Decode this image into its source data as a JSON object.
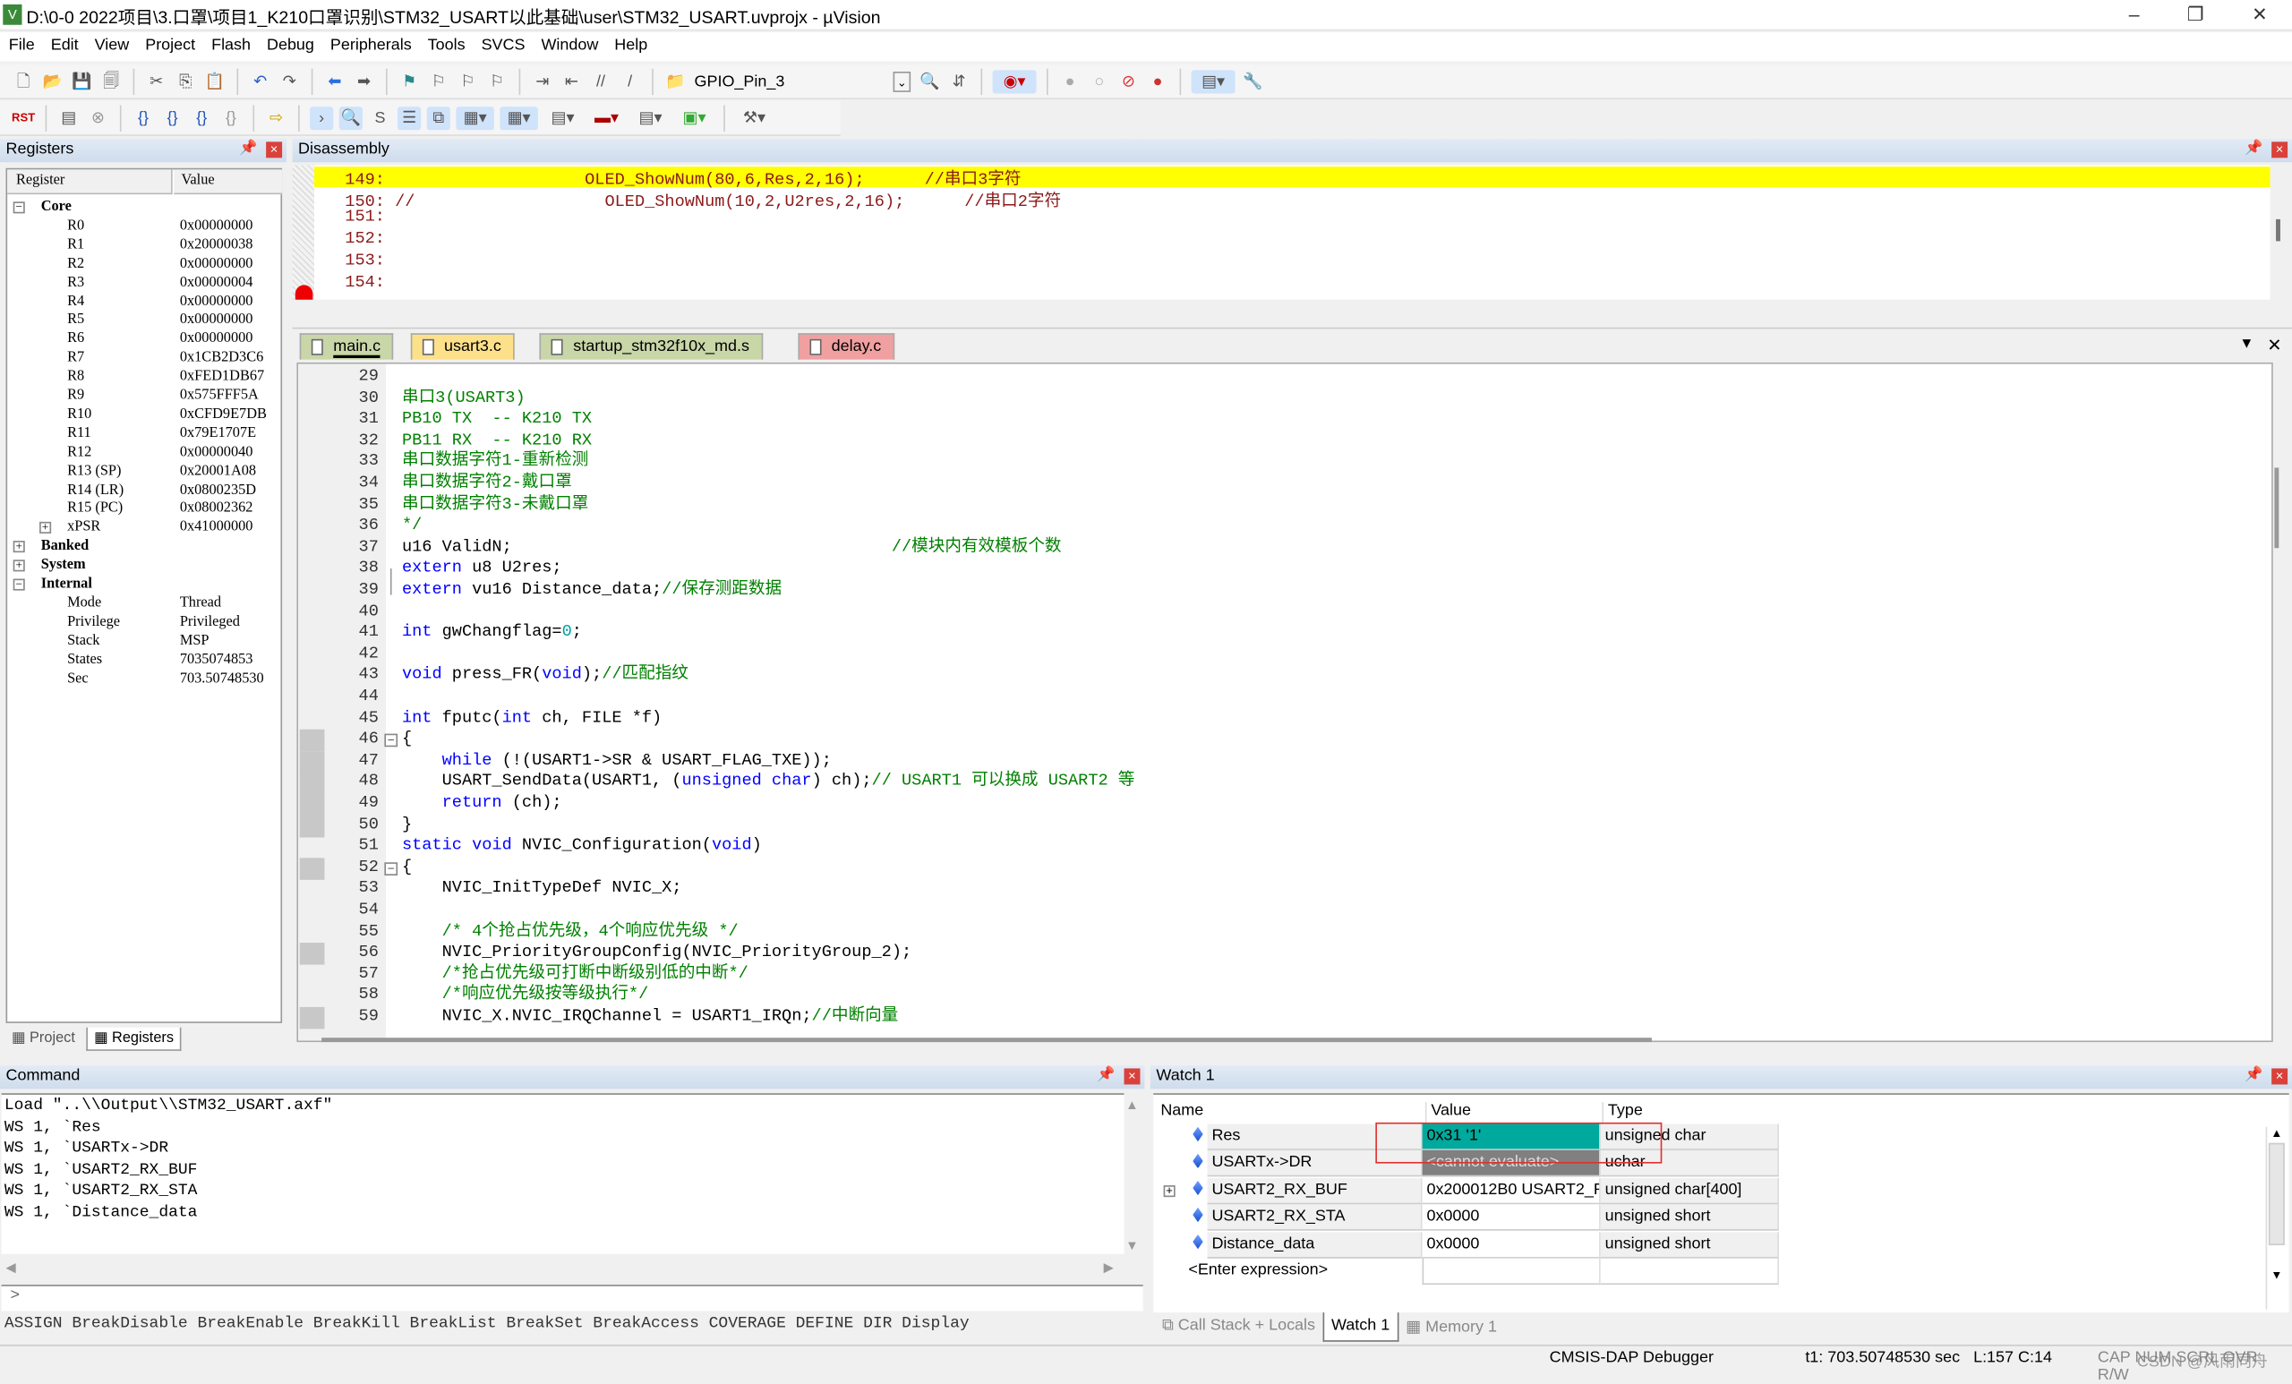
{
  "window": {
    "title": "D:\\0-0 2022项目\\3.口罩\\项目1_K210口罩识别\\STM32_USART以此基础\\user\\STM32_USART.uvprojx - µVision",
    "app_icon": "V"
  },
  "menu": [
    "File",
    "Edit",
    "View",
    "Project",
    "Flash",
    "Debug",
    "Peripherals",
    "Tools",
    "SVCS",
    "Window",
    "Help"
  ],
  "toolbar": {
    "target_combo": "GPIO_Pin_3",
    "rst_label": "RST"
  },
  "registers": {
    "title": "Registers",
    "col_register": "Register",
    "col_value": "Value",
    "rows": [
      {
        "name": "Core",
        "value": "",
        "level": 0,
        "exp": "-"
      },
      {
        "name": "R0",
        "value": "0x00000000",
        "level": 2
      },
      {
        "name": "R1",
        "value": "0x20000038",
        "level": 2
      },
      {
        "name": "R2",
        "value": "0x00000000",
        "level": 2
      },
      {
        "name": "R3",
        "value": "0x00000004",
        "level": 2
      },
      {
        "name": "R4",
        "value": "0x00000000",
        "level": 2
      },
      {
        "name": "R5",
        "value": "0x00000000",
        "level": 2
      },
      {
        "name": "R6",
        "value": "0x00000000",
        "level": 2
      },
      {
        "name": "R7",
        "value": "0x1CB2D3C6",
        "level": 2
      },
      {
        "name": "R8",
        "value": "0xFED1DB67",
        "level": 2
      },
      {
        "name": "R9",
        "value": "0x575FFF5A",
        "level": 2
      },
      {
        "name": "R10",
        "value": "0xCFD9E7DB",
        "level": 2
      },
      {
        "name": "R11",
        "value": "0x79E1707E",
        "level": 2
      },
      {
        "name": "R12",
        "value": "0x00000040",
        "level": 2
      },
      {
        "name": "R13 (SP)",
        "value": "0x20001A08",
        "level": 2
      },
      {
        "name": "R14 (LR)",
        "value": "0x0800235D",
        "level": 2
      },
      {
        "name": "R15 (PC)",
        "value": "0x08002362",
        "level": 2
      },
      {
        "name": "xPSR",
        "value": "0x41000000",
        "level": 1,
        "exp": "+"
      },
      {
        "name": "Banked",
        "value": "",
        "level": 0,
        "exp": "+"
      },
      {
        "name": "System",
        "value": "",
        "level": 0,
        "exp": "+"
      },
      {
        "name": "Internal",
        "value": "",
        "level": 0,
        "exp": "-"
      },
      {
        "name": "Mode",
        "value": "Thread",
        "level": 2
      },
      {
        "name": "Privilege",
        "value": "Privileged",
        "level": 2
      },
      {
        "name": "Stack",
        "value": "MSP",
        "level": 2
      },
      {
        "name": "States",
        "value": "7035074853",
        "level": 2
      },
      {
        "name": "Sec",
        "value": "703.50748530",
        "level": 2
      }
    ],
    "tabs": [
      {
        "label": "Project"
      },
      {
        "label": "Registers"
      }
    ]
  },
  "disassembly": {
    "title": "Disassembly",
    "lines": [
      {
        "n": "149:",
        "code": "                    OLED_ShowNum(80,6,Res,2,16);",
        "comment": "//串口3字符",
        "current": true
      },
      {
        "n": "150:",
        "code": " //                   OLED_ShowNum(10,2,U2res,2,16);",
        "comment": "//串口2字符"
      },
      {
        "n": "151:",
        "code": ""
      },
      {
        "n": "152:",
        "code": ""
      },
      {
        "n": "153:",
        "code": ""
      },
      {
        "n": "154:",
        "code": ""
      }
    ]
  },
  "editor": {
    "tabs": [
      {
        "label": "main.c",
        "color": "#c8d6a8",
        "active": true
      },
      {
        "label": "usart3.c",
        "color": "#fde08a"
      },
      {
        "label": "startup_stm32f10x_md.s",
        "color": "#c8d6a8"
      },
      {
        "label": "delay.c",
        "color": "#f0a0a0"
      }
    ],
    "lines": [
      {
        "n": "29",
        "segs": []
      },
      {
        "n": "30",
        "segs": [
          {
            "t": "cm",
            "s": "串口3(USART3)"
          }
        ]
      },
      {
        "n": "31",
        "segs": [
          {
            "t": "cm",
            "s": "PB10 TX  -- K210 TX"
          }
        ]
      },
      {
        "n": "32",
        "segs": [
          {
            "t": "cm",
            "s": "PB11 RX  -- K210 RX"
          }
        ]
      },
      {
        "n": "33",
        "segs": [
          {
            "t": "cm",
            "s": "串口数据字符1-重新检测"
          }
        ]
      },
      {
        "n": "34",
        "segs": [
          {
            "t": "cm",
            "s": "串口数据字符2-戴口罩"
          }
        ]
      },
      {
        "n": "35",
        "segs": [
          {
            "t": "cm",
            "s": "串口数据字符3-未戴口罩"
          }
        ]
      },
      {
        "n": "36",
        "segs": [
          {
            "t": "cm",
            "s": "*/"
          }
        ]
      },
      {
        "n": "37",
        "segs": [
          {
            "t": "tx",
            "s": "u16 ValidN;                                      "
          },
          {
            "t": "cm",
            "s": "//模块内有效模板个数"
          }
        ]
      },
      {
        "n": "38",
        "segs": [
          {
            "t": "kw",
            "s": "extern"
          },
          {
            "t": "tx",
            "s": " u8 U2res;"
          }
        ]
      },
      {
        "n": "39",
        "segs": [
          {
            "t": "kw",
            "s": "extern"
          },
          {
            "t": "tx",
            "s": " vu16 Distance_data;"
          },
          {
            "t": "cm",
            "s": "//保存测距数据"
          }
        ]
      },
      {
        "n": "40",
        "segs": []
      },
      {
        "n": "41",
        "segs": [
          {
            "t": "kw",
            "s": "int"
          },
          {
            "t": "tx",
            "s": " gwChangflag="
          },
          {
            "t": "num",
            "s": "0"
          },
          {
            "t": "tx",
            "s": ";"
          }
        ]
      },
      {
        "n": "42",
        "segs": []
      },
      {
        "n": "43",
        "segs": [
          {
            "t": "kw",
            "s": "void"
          },
          {
            "t": "tx",
            "s": " press_FR("
          },
          {
            "t": "kw",
            "s": "void"
          },
          {
            "t": "tx",
            "s": ");"
          },
          {
            "t": "cm",
            "s": "//匹配指纹"
          }
        ]
      },
      {
        "n": "44",
        "segs": []
      },
      {
        "n": "45",
        "segs": [
          {
            "t": "kw",
            "s": "int"
          },
          {
            "t": "tx",
            "s": " fputc("
          },
          {
            "t": "kw",
            "s": "int"
          },
          {
            "t": "tx",
            "s": " ch, FILE *f)"
          }
        ]
      },
      {
        "n": "46",
        "segs": [
          {
            "t": "tx",
            "s": "{"
          }
        ],
        "fold": true,
        "mark": true
      },
      {
        "n": "47",
        "segs": [
          {
            "t": "tx",
            "s": "    "
          },
          {
            "t": "kw",
            "s": "while"
          },
          {
            "t": "tx",
            "s": " (!(USART1->SR & USART_FLAG_TXE));"
          }
        ],
        "mark": true
      },
      {
        "n": "48",
        "segs": [
          {
            "t": "tx",
            "s": "    USART_SendData(USART1, ("
          },
          {
            "t": "kw",
            "s": "unsigned char"
          },
          {
            "t": "tx",
            "s": ") ch);"
          },
          {
            "t": "cm",
            "s": "// USART1 可以换成 USART2 等"
          }
        ],
        "mark": true
      },
      {
        "n": "49",
        "segs": [
          {
            "t": "tx",
            "s": "    "
          },
          {
            "t": "kw",
            "s": "return"
          },
          {
            "t": "tx",
            "s": " (ch);"
          }
        ],
        "mark": true
      },
      {
        "n": "50",
        "segs": [
          {
            "t": "tx",
            "s": "}"
          }
        ],
        "mark": true
      },
      {
        "n": "51",
        "segs": [
          {
            "t": "kw",
            "s": "static void"
          },
          {
            "t": "tx",
            "s": " NVIC_Configuration("
          },
          {
            "t": "kw",
            "s": "void"
          },
          {
            "t": "tx",
            "s": ")"
          }
        ]
      },
      {
        "n": "52",
        "segs": [
          {
            "t": "tx",
            "s": "{"
          }
        ],
        "fold": true,
        "mark": true
      },
      {
        "n": "53",
        "segs": [
          {
            "t": "tx",
            "s": "    NVIC_InitTypeDef NVIC_X;"
          }
        ]
      },
      {
        "n": "54",
        "segs": []
      },
      {
        "n": "55",
        "segs": [
          {
            "t": "tx",
            "s": "    "
          },
          {
            "t": "cm",
            "s": "/* 4个抢占优先级，4个响应优先级 */"
          }
        ]
      },
      {
        "n": "56",
        "segs": [
          {
            "t": "tx",
            "s": "    NVIC_PriorityGroupConfig(NVIC_PriorityGroup_2);"
          }
        ],
        "mark": true
      },
      {
        "n": "57",
        "segs": [
          {
            "t": "tx",
            "s": "    "
          },
          {
            "t": "cm",
            "s": "/*抢占优先级可打断中断级别低的中断*/"
          }
        ]
      },
      {
        "n": "58",
        "segs": [
          {
            "t": "tx",
            "s": "    "
          },
          {
            "t": "cm",
            "s": "/*响应优先级按等级执行*/"
          }
        ]
      },
      {
        "n": "59",
        "segs": [
          {
            "t": "tx",
            "s": "    NVIC_X.NVIC_IRQChannel = USART1_IRQn;"
          },
          {
            "t": "cm",
            "s": "//中断向量"
          }
        ],
        "mark": true
      }
    ]
  },
  "command": {
    "title": "Command",
    "output": [
      "Load \"..\\\\Output\\\\STM32_USART.axf\"",
      "WS 1, `Res",
      "WS 1, `USARTx->DR",
      "WS 1, `USART2_RX_BUF",
      "WS 1, `USART2_RX_STA",
      "WS 1, `Distance_data"
    ],
    "prompt": ">",
    "input_value": "",
    "hints": "ASSIGN BreakDisable BreakEnable BreakKill BreakList BreakSet BreakAccess COVERAGE DEFINE DIR Display"
  },
  "watch": {
    "title": "Watch 1",
    "col_name": "Name",
    "col_value": "Value",
    "col_type": "Type",
    "rows": [
      {
        "name": "Res",
        "value": "0x31 '1'",
        "type": "unsigned char",
        "value_bg": "#00a99d"
      },
      {
        "name": "USARTx->DR",
        "value": "<cannot evaluate>",
        "type": "uchar",
        "value_bg": "#808080"
      },
      {
        "name": "USART2_RX_BUF",
        "value": "0x200012B0 USART2_R...",
        "type": "unsigned char[400]",
        "expandable": true
      },
      {
        "name": "USART2_RX_STA",
        "value": "0x0000",
        "type": "unsigned short"
      },
      {
        "name": "Distance_data",
        "value": "0x0000",
        "type": "unsigned short"
      }
    ],
    "enter_expression": "<Enter expression>",
    "tabs": [
      {
        "label": "Call Stack + Locals"
      },
      {
        "label": "Watch 1",
        "active": true
      },
      {
        "label": "Memory 1"
      }
    ],
    "highlight_color": "#e03030"
  },
  "status": {
    "debugger": "CMSIS-DAP Debugger",
    "time": "t1: 703.50748530 sec",
    "position": "L:157 C:14",
    "flags": "CAP  NUM  SCRL  OVR  R/W",
    "watermark": "CSDN @风雨同舟"
  }
}
